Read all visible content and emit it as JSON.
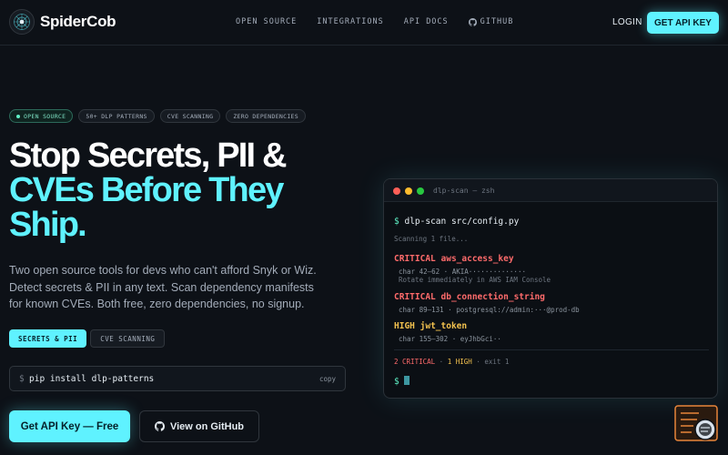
{
  "nav": {
    "brand": "SpiderCob",
    "links": [
      "OPEN SOURCE",
      "INTEGRATIONS",
      "API DOCS",
      "GITHUB"
    ],
    "login": "LOGIN",
    "cta": "GET API KEY"
  },
  "hero": {
    "tags": [
      "OPEN SOURCE",
      "50+ DLP PATTERNS",
      "CVE SCANNING",
      "ZERO DEPENDENCIES"
    ],
    "headline_1": "Stop Secrets, PII &",
    "headline_2": "CVEs Before They",
    "headline_3": "Ship.",
    "subtext": "Two open source tools for devs who can't afford Snyk or Wiz. Detect secrets & PII in any text. Scan dependency manifests for known CVEs. Both free, zero dependencies, no signup.",
    "toggles": [
      "SECRETS & PII",
      "CVE SCANNING"
    ],
    "install": {
      "prompt": "$",
      "command": "pip install dlp-patterns",
      "copy": "copy"
    },
    "cta_primary": "Get API Key — Free",
    "cta_secondary": "View on GitHub"
  },
  "terminal": {
    "title": "dlp-scan — zsh",
    "prompt": "$",
    "command": "dlp-scan src/config.py",
    "scanning": "Scanning 1 file...",
    "findings": [
      {
        "severity": "CRITICAL",
        "name": "aws_access_key",
        "detail": "char 42–62 · AKIA··············",
        "note": "Rotate immediately in AWS IAM Console"
      },
      {
        "severity": "CRITICAL",
        "name": "db_connection_string",
        "detail": "char 89–131 · postgresql://admin:···@prod-db",
        "note": ""
      },
      {
        "severity": "HIGH",
        "name": "jwt_token",
        "detail": "char 155–302 · eyJhbGci··",
        "note": ""
      }
    ],
    "summary": {
      "critical": "2 CRITICAL",
      "sep": "·",
      "high": "1 HIGH",
      "exit": "· exit 1"
    },
    "caret": "$"
  },
  "colors": {
    "background": "#0d1117",
    "accent": "#5ff2ff",
    "critical": "#ff6b6b",
    "high": "#f2c14e",
    "widget": "#e8853a"
  },
  "icons": [
    "spider-logo-icon",
    "github-icon",
    "chat-widget-icon"
  ]
}
